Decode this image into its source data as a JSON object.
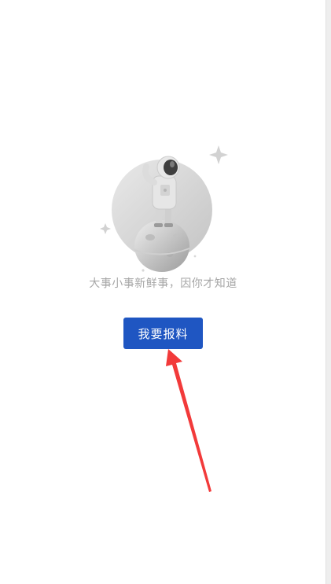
{
  "empty_state": {
    "illustration_icon": "astronaut-on-planet-icon",
    "message": "大事小事新鲜事，因你才知道"
  },
  "actions": {
    "report_label": "我要报料"
  },
  "colors": {
    "button": "#1f56c2",
    "message_text": "#a6a6a6",
    "annotation_arrow": "#f23a3a"
  }
}
